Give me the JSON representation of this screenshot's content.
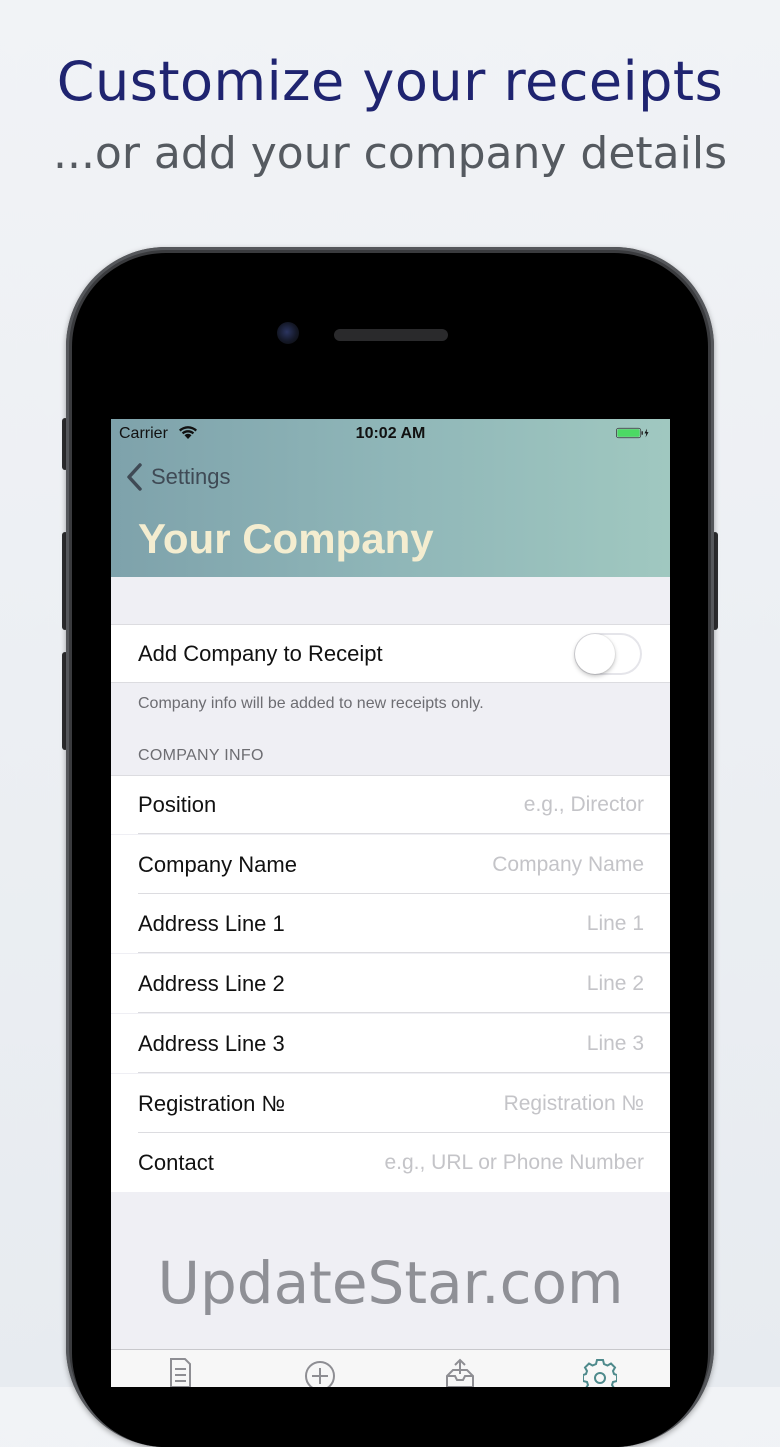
{
  "promo": {
    "headline": "Customize your receipts",
    "subline": "...or add your company details"
  },
  "status_bar": {
    "carrier": "Carrier",
    "time": "10:02 AM",
    "battery_color": "#4cd964"
  },
  "nav": {
    "back_label": "Settings",
    "title": "Your Company"
  },
  "toggle_row": {
    "label": "Add Company to Receipt",
    "enabled": false
  },
  "footnote": "Company info will be added to new receipts only.",
  "section_header": "COMPANY INFO",
  "fields": [
    {
      "label": "Position",
      "placeholder": "e.g., Director",
      "value": ""
    },
    {
      "label": "Company Name",
      "placeholder": "Company Name",
      "value": ""
    },
    {
      "label": "Address Line 1",
      "placeholder": "Line 1",
      "value": ""
    },
    {
      "label": "Address Line 2",
      "placeholder": "Line 2",
      "value": ""
    },
    {
      "label": "Address Line 3",
      "placeholder": "Line 3",
      "value": ""
    },
    {
      "label": "Registration №",
      "placeholder": "Registration №",
      "value": ""
    },
    {
      "label": "Contact",
      "placeholder": "e.g., URL or Phone Number",
      "value": ""
    }
  ],
  "watermark": "UpdateStar.com",
  "tabs": [
    {
      "icon": "receipts-icon"
    },
    {
      "icon": "add-icon"
    },
    {
      "icon": "export-icon"
    },
    {
      "icon": "gear-icon",
      "active": true
    }
  ],
  "colors": {
    "headline": "#1f2470",
    "header_gradient_start": "#7ea2ab",
    "header_gradient_end": "#a0c8c0",
    "title": "#f4edd0",
    "tab_inactive": "#8e8e93",
    "tab_active": "#4e8a8c"
  }
}
